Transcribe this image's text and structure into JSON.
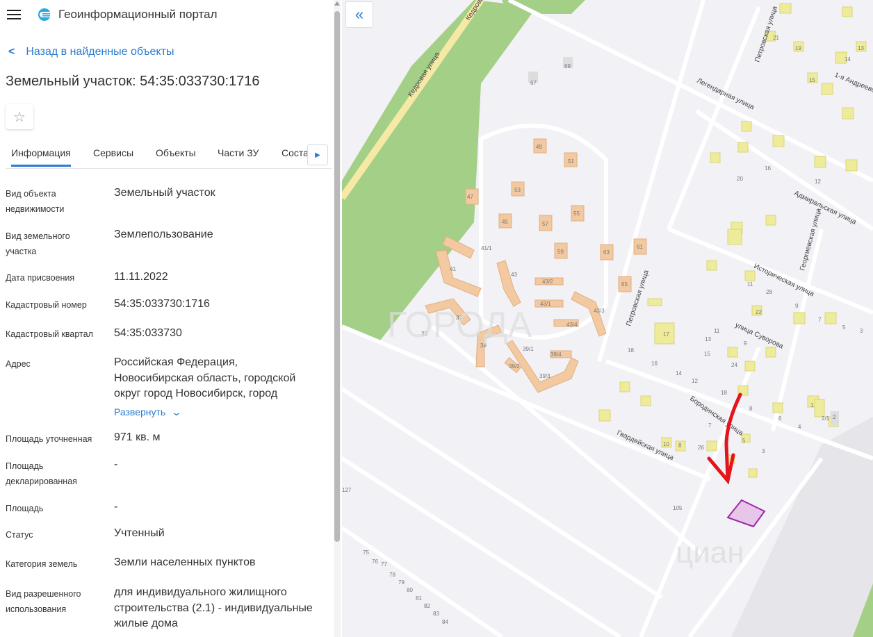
{
  "header": {
    "app_title": "Геоинформационный портал",
    "menu_icon": "hamburger-icon",
    "logo_icon": "portal-logo-icon"
  },
  "back_link": "Назад в найденные объекты",
  "page_title": "Земельный участок: 54:35:033730:1716",
  "favorite_icon": "star-icon",
  "tabs": [
    {
      "label": "Информация",
      "active": true
    },
    {
      "label": "Сервисы"
    },
    {
      "label": "Объекты"
    },
    {
      "label": "Части ЗУ"
    },
    {
      "label": "Соста"
    }
  ],
  "properties": [
    {
      "label": "Вид объекта недвижимости",
      "value": "Земельный участок"
    },
    {
      "label": "Вид земельного участка",
      "value": "Землепользование"
    },
    {
      "label": "Дата присвоения",
      "value": "11.11.2022"
    },
    {
      "label": "Кадастровый номер",
      "value": "54:35:033730:1716"
    },
    {
      "label": "Кадастровый квартал",
      "value": "54:35:033730"
    },
    {
      "label": "Адрес",
      "value": "Российская Федерация, Новосибирская область, городской округ город Новосибирск, город"
    },
    {
      "label": "Площадь уточненная",
      "value": "971 кв. м"
    },
    {
      "label": "Площадь декларированная",
      "value": "-"
    },
    {
      "label": "Площадь",
      "value": "-"
    },
    {
      "label": "Статус",
      "value": "Учтенный"
    },
    {
      "label": "Категория земель",
      "value": "Земли населенных пунктов"
    },
    {
      "label": "Вид разрешенного использования",
      "value": "для индивидуального жилищного строительства (2.1) - индивидуальные жилые дома"
    }
  ],
  "expand_label": "Развернуть",
  "map": {
    "streets": {
      "kedrovaya": "Кедровая улица",
      "kedrovaya2": "Кедровая",
      "legendarnaya": "Легендарная улица",
      "petrovskaya": "Петровская улица",
      "andreevskaya": "1-я Андреевс",
      "admiralskaya": "Адмиральская улица",
      "georgievskaya": "Георгиевская улица",
      "istoricheskaya": "Историческая улица",
      "suvorova": "улица Суворова",
      "borodinskaya": "Бородинская улица",
      "gvardeyskaya": "Гвардейская улица",
      "petrovskaya2": "Петровская улица"
    },
    "watermarks": [
      "ГОРОДА",
      "циан"
    ],
    "colors": {
      "background": "#f2f1f6",
      "green": "#a3cf86",
      "apartment": "#f2c9a0",
      "house": "#eeeb9b",
      "parcel_fill": "#e8c6ea",
      "parcel_stroke": "#9b2aa8",
      "arrow": "#e3141b"
    },
    "house_numbers": [
      "49",
      "51",
      "47",
      "53",
      "45",
      "57",
      "55",
      "63",
      "61",
      "59",
      "41/1",
      "41",
      "43",
      "43/2",
      "43/1",
      "43/3",
      "43/4",
      "65",
      "37",
      "39",
      "39/1",
      "39/4",
      "39/2",
      "39/3",
      "35",
      "17",
      "18",
      "16",
      "14",
      "12",
      "15",
      "13",
      "11",
      "9",
      "24",
      "18",
      "8",
      "6",
      "4",
      "1",
      "2/1",
      "2",
      "7",
      "5",
      "3",
      "10",
      "8",
      "26",
      "105",
      "127",
      "75",
      "76",
      "77",
      "78",
      "79",
      "80",
      "81",
      "82",
      "83",
      "84",
      "67",
      "69",
      "21",
      "19",
      "15",
      "14",
      "13",
      "12",
      "20",
      "16",
      "11",
      "28",
      "22",
      "9",
      "7",
      "5",
      "3"
    ],
    "collapse_icon": "double-chevron-left-icon"
  }
}
